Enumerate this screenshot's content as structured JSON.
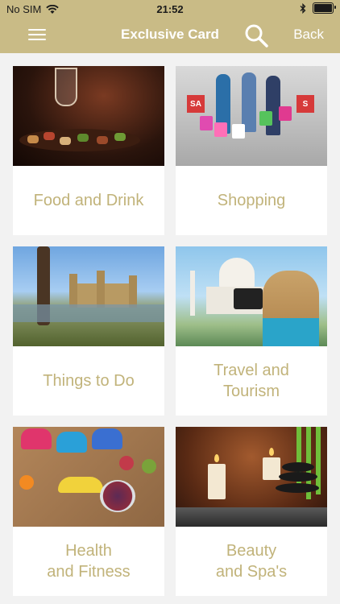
{
  "status_bar": {
    "carrier": "No SIM",
    "time": "21:52",
    "battery_level": 1.0
  },
  "nav": {
    "title": "Exclusive Card",
    "back_label": "Back",
    "menu_icon": "hamburger-menu-icon",
    "search_icon": "search-icon"
  },
  "colors": {
    "header": "#c9bb86",
    "label": "#c1b37a",
    "background": "#f2f2f2"
  },
  "categories": [
    {
      "label": "Food and Drink"
    },
    {
      "label": "Shopping"
    },
    {
      "label": "Things to Do"
    },
    {
      "label": "Travel and\nTourism"
    },
    {
      "label": "Health\nand Fitness"
    },
    {
      "label": "Beauty\nand Spa's"
    }
  ]
}
